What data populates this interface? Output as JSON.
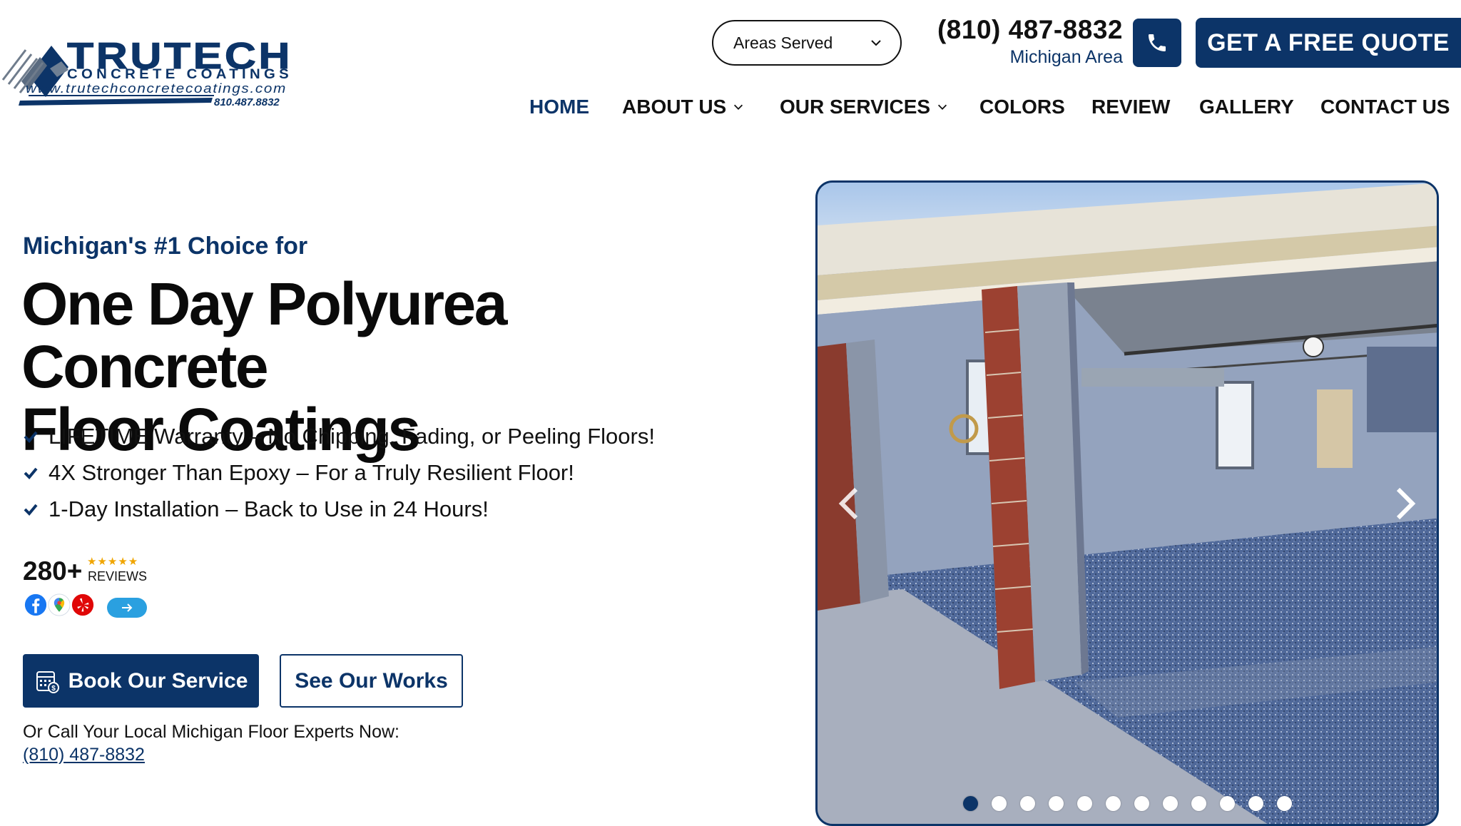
{
  "brand": {
    "name_primary": "TRUTECH",
    "name_secondary": "CONCRETE COATINGS",
    "website": "www.trutechconcretecoatings.com",
    "phone_small": "810.487.8832"
  },
  "header": {
    "areas_label": "Areas Served",
    "phone": "(810) 487-8832",
    "phone_area": "Michigan Area",
    "quote_label": "GET A FREE QUOTE"
  },
  "nav": {
    "items": [
      {
        "label": "HOME",
        "active": true
      },
      {
        "label": "ABOUT US",
        "dropdown": true
      },
      {
        "label": "OUR SERVICES",
        "dropdown": true
      },
      {
        "label": "COLORS"
      },
      {
        "label": "REVIEW"
      },
      {
        "label": "GALLERY"
      },
      {
        "label": "CONTACT US"
      }
    ]
  },
  "hero": {
    "eyebrow": "Michigan's #1 Choice for",
    "headline_line1": "One Day Polyurea Concrete",
    "headline_line2": "Floor Coatings",
    "features": [
      "LIFETIME Warranty – No Chipping, Fading, or Peeling Floors!",
      "4X Stronger Than Epoxy – For a Truly Resilient Floor!",
      "1-Day Installation – Back to Use in 24 Hours!"
    ],
    "reviews_count": "280+",
    "reviews_stars": "★★★★★",
    "reviews_label": "REVIEWS",
    "review_sources": [
      "facebook-icon",
      "google-maps-icon",
      "yelp-icon"
    ],
    "book_label": "Book Our Service",
    "see_label": "See Our Works",
    "call_text": "Or Call Your Local Michigan Floor Experts Now:",
    "call_phone": "(810) 487-8832"
  },
  "slider": {
    "slide_count": 12,
    "active_index": 0
  },
  "colors": {
    "brand_navy": "#0c3468",
    "star": "#f0a500",
    "accent_blue": "#2aa0e0"
  }
}
